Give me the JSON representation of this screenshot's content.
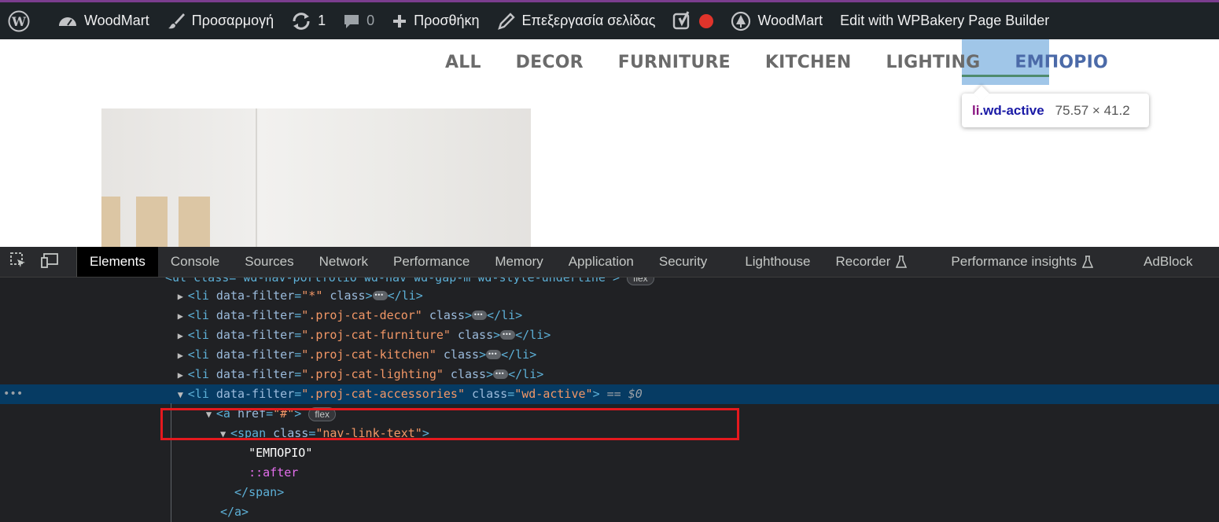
{
  "admin_bar": {
    "site": "WoodMart",
    "customize": "Προσαρμογή",
    "updates": "1",
    "comments": "0",
    "new": "Προσθήκη",
    "edit_page": "Επεξεργασία σελίδας",
    "theme": "WoodMart",
    "builder": "Edit with WPBakery Page Builder"
  },
  "filters": [
    "ALL",
    "DECOR",
    "FURNITURE",
    "KITCHEN",
    "LIGHTING",
    "ΕΜΠΟΡΙΟ"
  ],
  "tooltip": {
    "tag": "li",
    "class": ".wd-active",
    "dims": "75.57 × 41.2"
  },
  "devtools": {
    "tabs": [
      "Elements",
      "Console",
      "Sources",
      "Network",
      "Performance",
      "Memory",
      "Application",
      "Security",
      "Lighthouse",
      "Recorder",
      "Performance insights",
      "AdBlock"
    ],
    "active_tab": "Elements",
    "lines": {
      "ul_cut": "<ul class=\"wd-nav-portfolio wd-nav wd-gap-m wd-style-underline\">",
      "li1_attr": "\"*\"",
      "li2_attr": "\".proj-cat-decor\"",
      "li3_attr": "\".proj-cat-furniture\"",
      "li4_attr": "\".proj-cat-kitchen\"",
      "li5_attr": "\".proj-cat-lighting\"",
      "li6_attr": "\".proj-cat-accessories\"",
      "li6_class": "\"wd-active\"",
      "li6_ref": "== $0",
      "a_href": "\"#\"",
      "span_class": "\"nav-link-text\"",
      "text_node": "\"ΕΜΠΟΡΙΟ\"",
      "pseudo": "::after",
      "badge": "flex"
    }
  },
  "colors": {
    "admin_bg": "#1d2327",
    "devtools_bg": "#202124",
    "selected_row": "#063b63",
    "highlight_box": "#e5191e"
  }
}
